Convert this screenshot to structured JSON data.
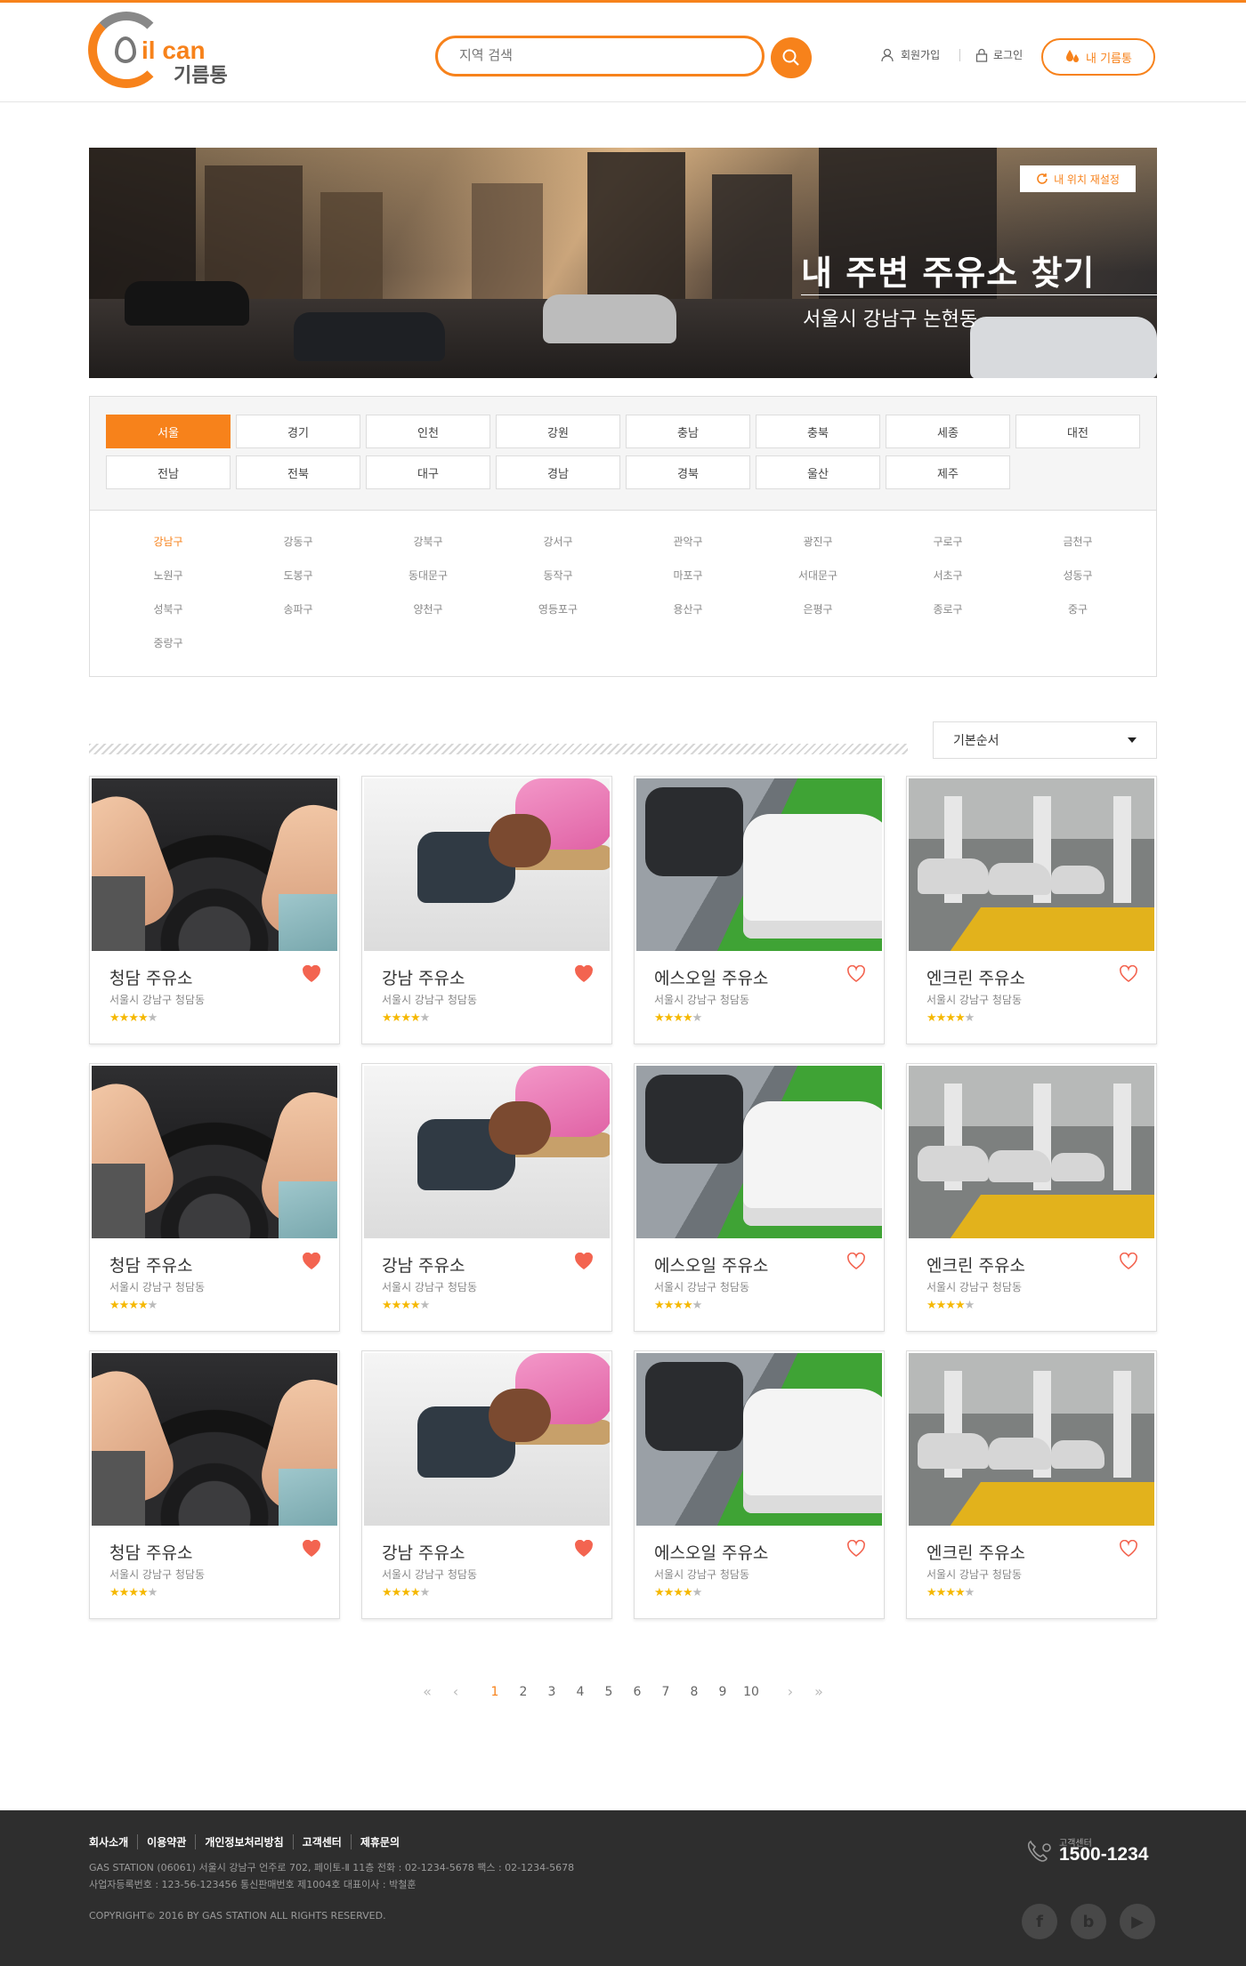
{
  "header": {
    "logo_main": "il can",
    "logo_sub": "기름통",
    "search_placeholder": "지역 검색",
    "signup": "회원가입",
    "login": "로그인",
    "my_fuel": "내 기름통",
    "accent": "#f7821b"
  },
  "banner": {
    "reset_label": "내 위치 재설정",
    "title": "내 주변 주유소 찾기",
    "location": "서울시 강남구 논현동"
  },
  "regions": [
    "서울",
    "경기",
    "인천",
    "강원",
    "충남",
    "충북",
    "세종",
    "대전",
    "전남",
    "전북",
    "대구",
    "경남",
    "경북",
    "울산",
    "제주"
  ],
  "active_region": "서울",
  "districts": [
    "강남구",
    "강동구",
    "강북구",
    "강서구",
    "관악구",
    "광진구",
    "구로구",
    "금천구",
    "노원구",
    "도봉구",
    "동대문구",
    "동작구",
    "마포구",
    "서대문구",
    "서초구",
    "성동구",
    "성북구",
    "송파구",
    "양천구",
    "영등포구",
    "용산구",
    "은평구",
    "종로구",
    "중구",
    "중랑구"
  ],
  "active_district": "강남구",
  "sort": {
    "selected": "기본순서"
  },
  "stations": [
    {
      "name": "청담 주유소",
      "addr": "서울시 강남구 청담동",
      "rating": 4,
      "favorite": true,
      "image": "steering-wheel"
    },
    {
      "name": "강남 주유소",
      "addr": "서울시 강남구 청담동",
      "rating": 4,
      "favorite": true,
      "image": "fuel-nozzle"
    },
    {
      "name": "에스오일 주유소",
      "addr": "서울시 강남구 청담동",
      "rating": 4,
      "favorite": false,
      "image": "parked-cars"
    },
    {
      "name": "엔크린 주유소",
      "addr": "서울시 강남구 청담동",
      "rating": 4,
      "favorite": false,
      "image": "parking-garage"
    },
    {
      "name": "청담 주유소",
      "addr": "서울시 강남구 청담동",
      "rating": 4,
      "favorite": true,
      "image": "steering-wheel"
    },
    {
      "name": "강남 주유소",
      "addr": "서울시 강남구 청담동",
      "rating": 4,
      "favorite": true,
      "image": "fuel-nozzle"
    },
    {
      "name": "에스오일 주유소",
      "addr": "서울시 강남구 청담동",
      "rating": 4,
      "favorite": false,
      "image": "parked-cars"
    },
    {
      "name": "엔크린 주유소",
      "addr": "서울시 강남구 청담동",
      "rating": 4,
      "favorite": false,
      "image": "parking-garage"
    },
    {
      "name": "청담 주유소",
      "addr": "서울시 강남구 청담동",
      "rating": 4,
      "favorite": true,
      "image": "steering-wheel"
    },
    {
      "name": "강남 주유소",
      "addr": "서울시 강남구 청담동",
      "rating": 4,
      "favorite": true,
      "image": "fuel-nozzle"
    },
    {
      "name": "에스오일 주유소",
      "addr": "서울시 강남구 청담동",
      "rating": 4,
      "favorite": false,
      "image": "parked-cars"
    },
    {
      "name": "엔크린 주유소",
      "addr": "서울시 강남구 청담동",
      "rating": 4,
      "favorite": false,
      "image": "parking-garage"
    }
  ],
  "pagination": {
    "pages": [
      "1",
      "2",
      "3",
      "4",
      "5",
      "6",
      "7",
      "8",
      "9",
      "10"
    ],
    "current": "1",
    "first": "«",
    "prev": "‹",
    "next": "›",
    "last": "»"
  },
  "footer": {
    "links": [
      "회사소개",
      "이용약관",
      "개인정보처리방침",
      "고객센터",
      "제휴문의"
    ],
    "address": "GAS STATION (06061) 서울시 강남구 언주로 702, 페이토-Ⅱ 11층    전화 : 02-1234-5678    팩스 : 02-1234-5678",
    "biz": "사업자등록번호 : 123-56-123456   통신판매번호 제1004호   대표이사 : 박철훈",
    "copyright": "COPYRIGHT© 2016 BY GAS STATION ALL RIGHTS RESERVED.",
    "cs_label": "고객센터",
    "cs_number": "1500-1234",
    "social": [
      "f",
      "b",
      "▶"
    ]
  }
}
